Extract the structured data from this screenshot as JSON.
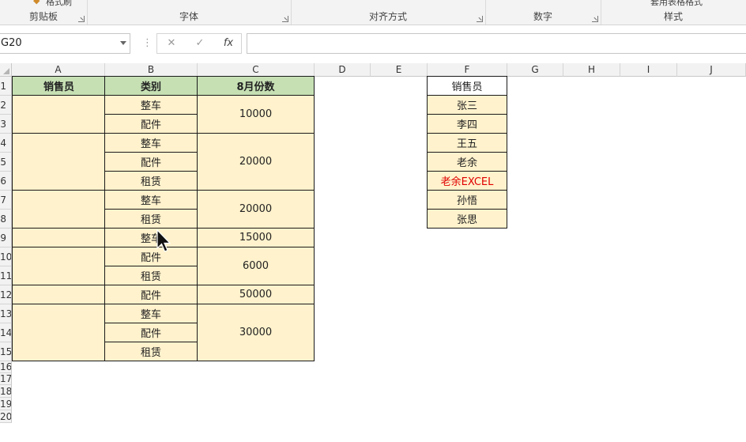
{
  "ribbon": {
    "top_partial_left": "格式刷",
    "top_partial_right": "套用表格格式",
    "groups": [
      {
        "label": "剪贴板"
      },
      {
        "label": "字体"
      },
      {
        "label": "对齐方式"
      },
      {
        "label": "数字"
      },
      {
        "label": "样式"
      }
    ]
  },
  "formula_bar": {
    "name_box": "G20",
    "cancel": "✕",
    "enter": "✓",
    "fx": "fx",
    "formula": ""
  },
  "columns": [
    "A",
    "B",
    "C",
    "D",
    "E",
    "F",
    "G",
    "H",
    "I",
    "J"
  ],
  "rows": [
    "1",
    "2",
    "3",
    "4",
    "5",
    "6",
    "7",
    "8",
    "9",
    "10",
    "11",
    "12",
    "13",
    "14",
    "15",
    "16",
    "17",
    "18",
    "19",
    "20"
  ],
  "table": {
    "header": {
      "a": "销售员",
      "b": "类别",
      "c": "8月份数"
    },
    "categories": [
      "整车",
      "配件",
      "整车",
      "配件",
      "租赁",
      "整车",
      "租赁",
      "整车",
      "配件",
      "租赁",
      "配件",
      "整车",
      "配件",
      "租赁"
    ],
    "counts": [
      "10000",
      "20000",
      "20000",
      "15000",
      "6000",
      "50000",
      "30000"
    ]
  },
  "list": {
    "header": "销售员",
    "names": [
      "张三",
      "李四",
      "王五",
      "老余",
      "老余EXCEL",
      "孙悟",
      "张思"
    ]
  }
}
